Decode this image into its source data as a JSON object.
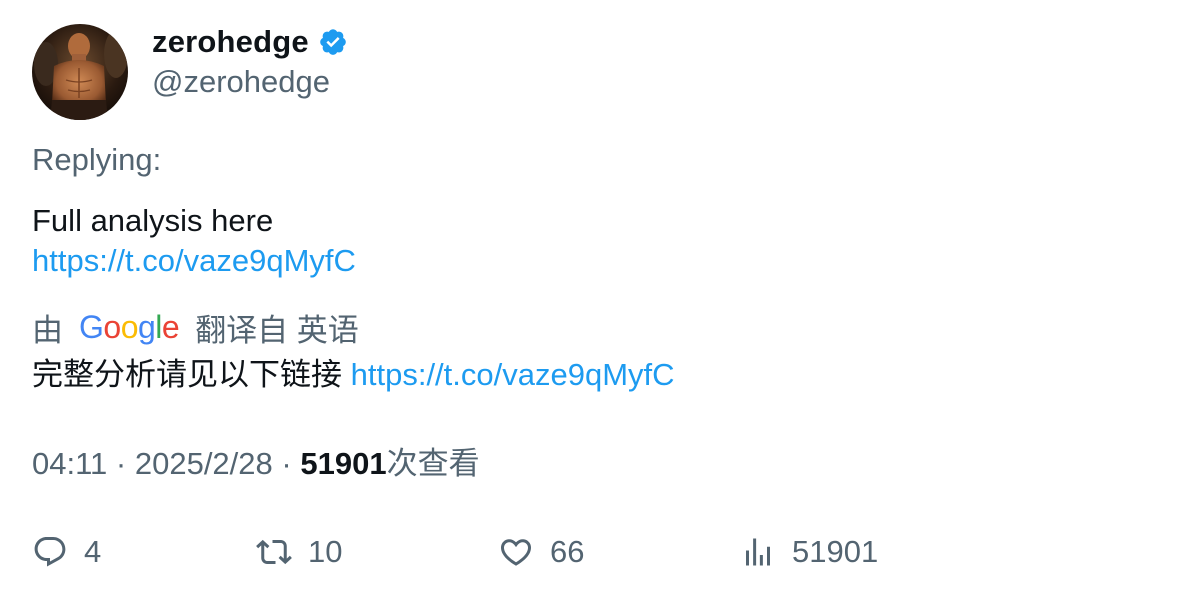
{
  "author": {
    "display_name": "zerohedge",
    "handle": "@zerohedge",
    "verified_icon": "verified-badge-icon",
    "avatar_icon": "profile-avatar"
  },
  "tweet": {
    "replying_label": "Replying:",
    "text": "Full analysis here",
    "link": "https://t.co/vaze9qMyfC"
  },
  "translation": {
    "prefix": "由",
    "provider_letters": [
      "G",
      "o",
      "o",
      "g",
      "l",
      "e"
    ],
    "suffix": "翻译自 英语",
    "translated_text": "完整分析请见以下链接",
    "translated_link": "https://t.co/vaze9qMyfC"
  },
  "meta": {
    "time": "04:11",
    "separator": "·",
    "date": "2025/2/28",
    "views_count": "51901",
    "views_label": "次查看"
  },
  "actions": {
    "replies": "4",
    "retweets": "10",
    "likes": "66",
    "views": "51901"
  },
  "colors": {
    "link": "#1d9bf0",
    "secondary_text": "#536471",
    "primary_text": "#0f1419",
    "google_blue": "#4285f4",
    "google_red": "#ea4335",
    "google_yellow": "#fbbc05",
    "google_green": "#34a853"
  }
}
